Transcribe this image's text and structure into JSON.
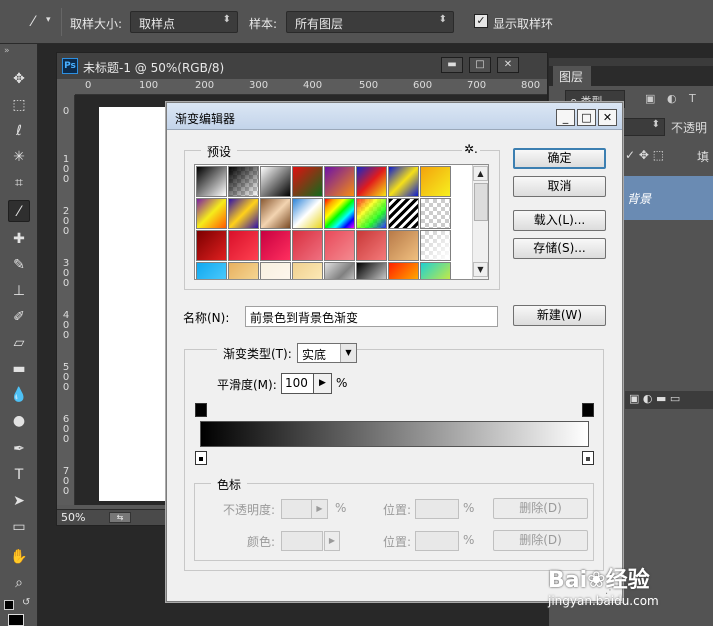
{
  "options_bar": {
    "sample_size_label": "取样大小:",
    "sample_size_value": "取样点",
    "sample_label": "样本:",
    "sample_value": "所有图层",
    "show_ring_label": "显示取样环",
    "show_ring_checked": "✓"
  },
  "document": {
    "title": "未标题-1 @ 50%(RGB/8)",
    "ps_badge": "Ps",
    "min_glyph": "▬",
    "max_glyph": "□",
    "close_glyph": "✕",
    "ruler_h": [
      "0",
      "100",
      "200",
      "300",
      "400",
      "500",
      "600",
      "700",
      "800"
    ],
    "ruler_v": [
      "0",
      "1\n0\n0",
      "2\n0\n0",
      "3\n0\n0",
      "4\n0\n0",
      "5\n0\n0",
      "6\n0\n0",
      "7\n0\n0"
    ],
    "zoom": "50%"
  },
  "layers_panel": {
    "tab_label": "图层",
    "kind_label": "ρ 类型",
    "opacity_label": "不透明",
    "fill_label": "填",
    "background_layer": "背景"
  },
  "gradient_editor": {
    "title": "渐变编辑器",
    "presets_label": "预设",
    "gear_glyph": "✲.",
    "ok_button": "确定",
    "cancel_button": "取消",
    "load_button": "载入(L)...",
    "save_button": "存储(S)...",
    "name_label": "名称(N):",
    "name_value": "前景色到背景色渐变",
    "new_button": "新建(W)",
    "gradient_type_label": "渐变类型(T):",
    "gradient_type_value": "实底",
    "smoothness_label": "平滑度(M):",
    "smoothness_value": "100",
    "percent": "%",
    "color_stops_label": "色标",
    "opacity_label": "不透明度:",
    "color_label": "颜色:",
    "location_label": "位置:",
    "delete_button": "删除(D)",
    "minimize_glyph": "_",
    "maximize_glyph": "□",
    "close_glyph": "✕",
    "scroll_up": "▲",
    "scroll_down": "▼",
    "dropdown_arrow": "▼",
    "play_arrow": "▶"
  },
  "watermark": {
    "brand": "Bai",
    "brand_suffix": "经验",
    "url": "jingyan.baidu.com"
  },
  "colors": {
    "dialog_bg": "#f0f0f0",
    "title_bar": "#c3d4ea",
    "layer_selected": "#6a8bb3",
    "ps_blue": "#2d8fe0"
  }
}
